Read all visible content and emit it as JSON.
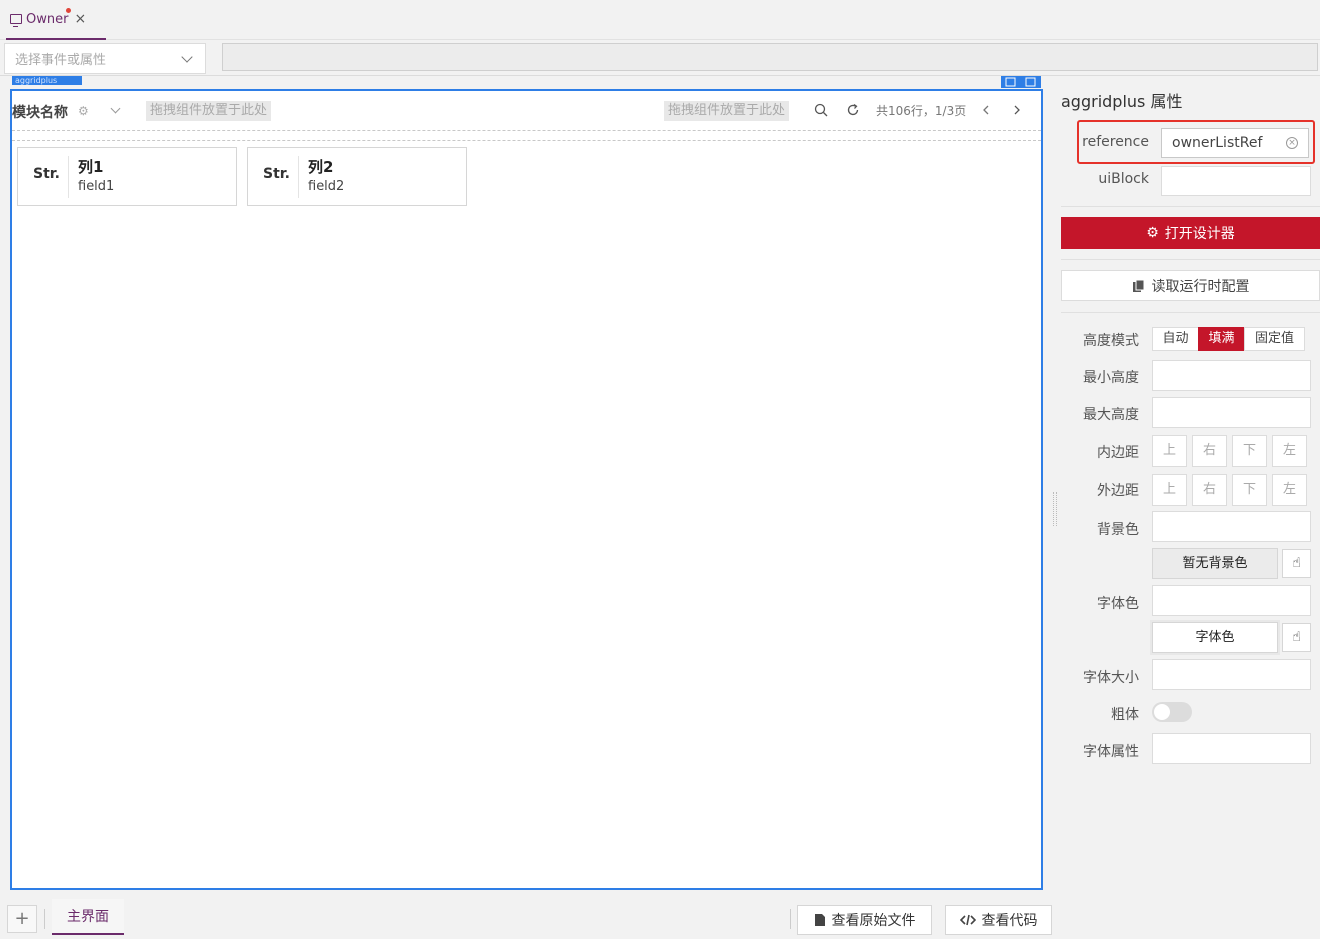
{
  "tabs": [
    {
      "label": "Owner",
      "close": "×"
    }
  ],
  "event_select": {
    "placeholder": "选择事件或属性"
  },
  "canvas": {
    "component_tag": "aggridplus",
    "module_name": "模块名称",
    "drop_left": "拖拽组件放置于此处",
    "drop_right": "拖拽组件放置于此处",
    "page_info": "共106行，1/3页",
    "columns": [
      {
        "type": "Str.",
        "title": "列1",
        "field": "field1"
      },
      {
        "type": "Str.",
        "title": "列2",
        "field": "field2"
      }
    ]
  },
  "panel": {
    "title": "aggridplus 属性",
    "reference_label": "reference",
    "reference_value": "ownerListRef",
    "uiblock_label": "uiBlock",
    "open_designer": "打开设计器",
    "read_runtime": "读取运行时配置",
    "height_mode_label": "高度模式",
    "height_modes": [
      "自动",
      "填满",
      "固定值"
    ],
    "height_mode_active": "填满",
    "min_height_label": "最小高度",
    "max_height_label": "最大高度",
    "padding_label": "内边距",
    "margin_label": "外边距",
    "sides": [
      "上",
      "右",
      "下",
      "左"
    ],
    "bg_color_label": "背景色",
    "no_bg_color": "暂无背景色",
    "font_color_label": "字体色",
    "font_color_swatch": "字体色",
    "font_size_label": "字体大小",
    "bold_label": "粗体",
    "font_attr_label": "字体属性"
  },
  "bottom": {
    "add": "+",
    "main_tab": "主界面",
    "view_source": "查看原始文件",
    "view_code": "查看代码"
  },
  "colors": {
    "accent": "#c4162a",
    "selection": "#2e7ee6",
    "tab": "#6b2b6b",
    "highlight": "#e5322a"
  }
}
